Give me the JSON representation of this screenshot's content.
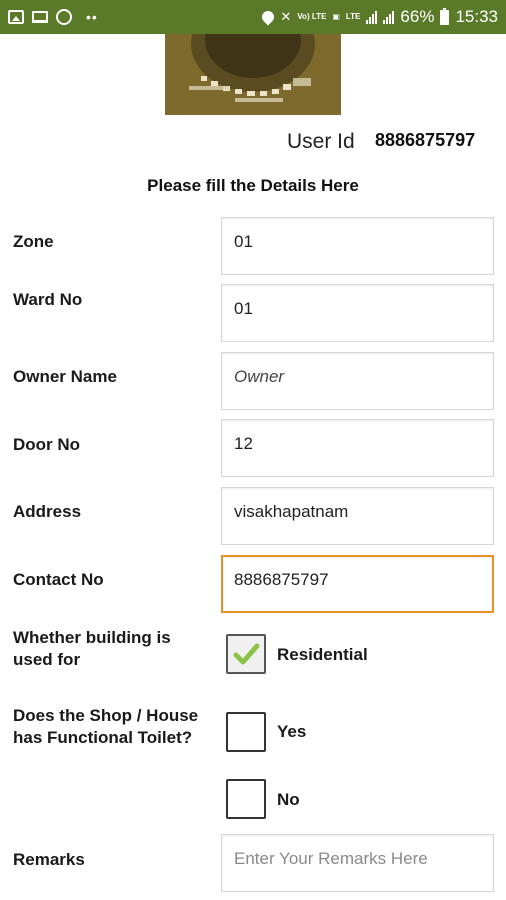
{
  "status_bar": {
    "battery": "66%",
    "time": "15:33",
    "volte": "Vo) LTE",
    "lte": "LTE",
    "dots": "••"
  },
  "user": {
    "label": "User Id",
    "value": "8886875797"
  },
  "form": {
    "heading": "Please fill the Details Here",
    "zone": {
      "label": "Zone",
      "value": "01"
    },
    "ward": {
      "label": "Ward No",
      "value": "01"
    },
    "owner": {
      "label": "Owner Name",
      "value": "Owner"
    },
    "door": {
      "label": "Door No",
      "value": "12"
    },
    "address": {
      "label": "Address",
      "value": "visakhapatnam"
    },
    "contact": {
      "label": "Contact No",
      "value": "8886875797"
    },
    "building_use": {
      "label": "Whether building is used for",
      "option": "Residential",
      "checked": true
    },
    "toilet": {
      "label": "Does the Shop / House has Functional Toilet?",
      "yes": "Yes",
      "no": "No"
    },
    "remarks": {
      "label": "Remarks",
      "placeholder": "Enter Your Remarks Here"
    }
  },
  "colors": {
    "status_bar": "#5a7a2a",
    "focus_border": "#e8922a",
    "check_green": "#8bc34a"
  }
}
